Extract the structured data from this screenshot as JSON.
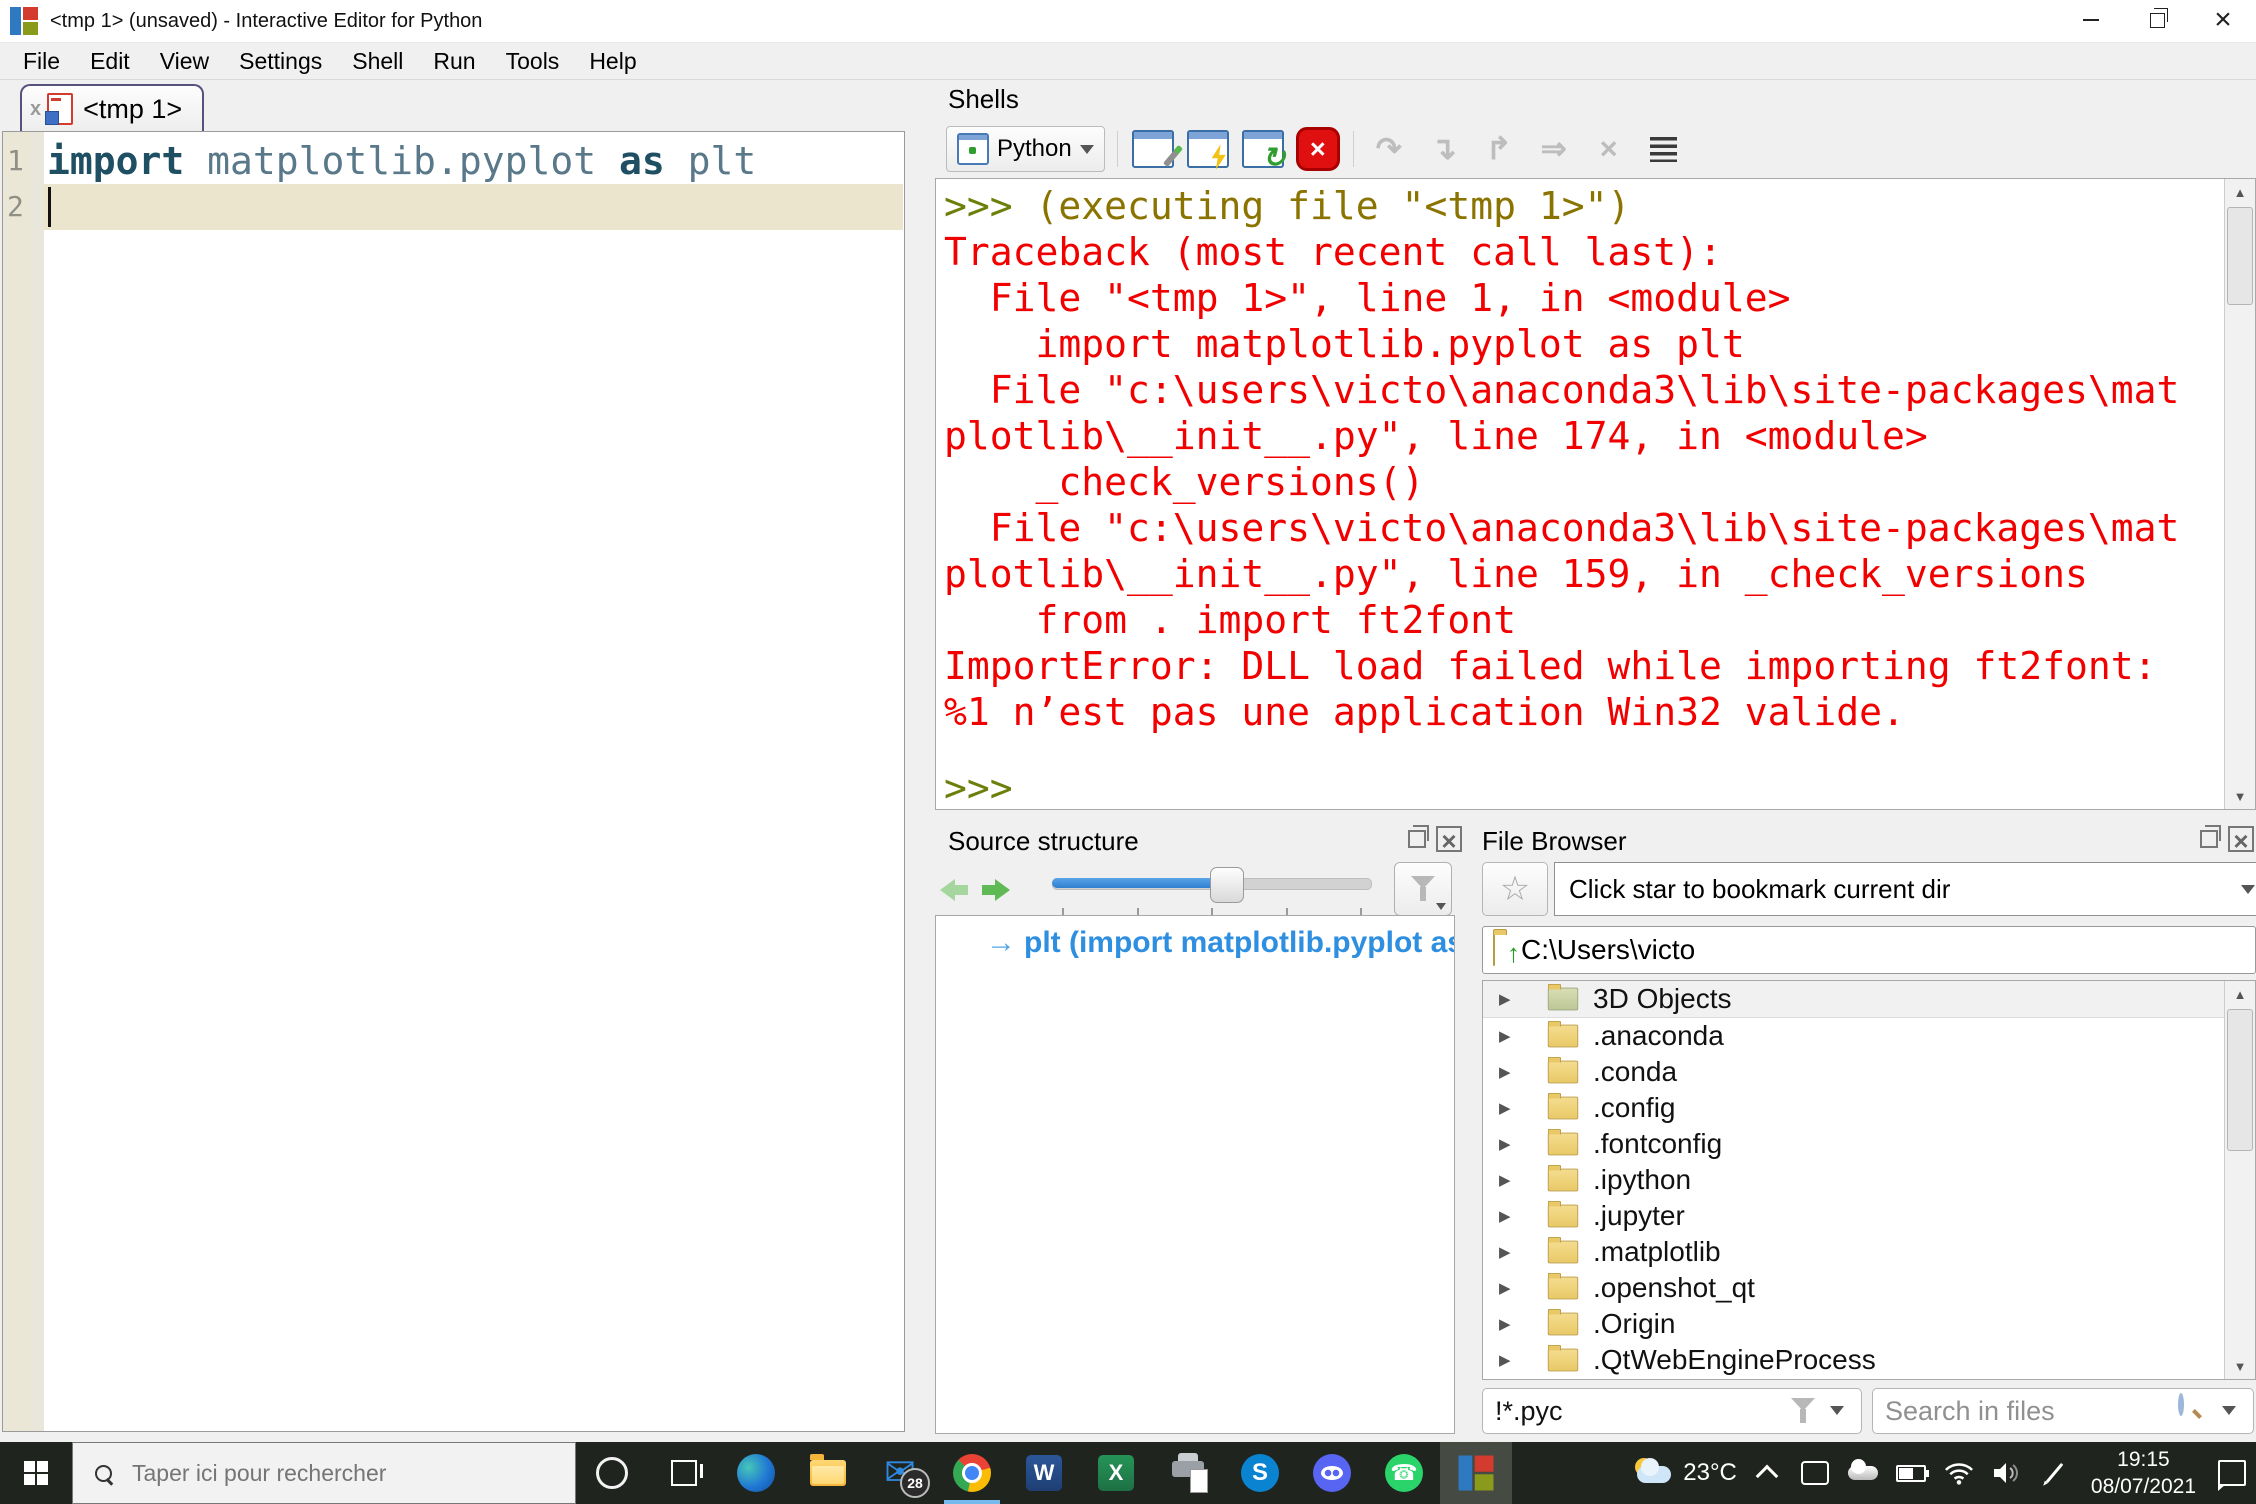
{
  "window": {
    "title": "<tmp 1> (unsaved) - Interactive Editor for Python"
  },
  "menu": {
    "items": [
      {
        "label": "File"
      },
      {
        "label": "Edit"
      },
      {
        "label": "View"
      },
      {
        "label": "Settings"
      },
      {
        "label": "Shell"
      },
      {
        "label": "Run"
      },
      {
        "label": "Tools"
      },
      {
        "label": "Help"
      }
    ]
  },
  "editor": {
    "tab_label": "<tmp 1>",
    "line_numbers": [
      {
        "n": "1"
      },
      {
        "n": "2"
      }
    ],
    "kw1": "import ",
    "module": "matplotlib.pyplot ",
    "kw2": "as ",
    "alias": "plt"
  },
  "shells": {
    "title": "Shells",
    "interpreter": "Python",
    "exec_prompt": ">>> ",
    "exec_text": "(executing file \"<tmp 1>\")",
    "traceback": [
      {
        "text": "Traceback (most recent call last):"
      },
      {
        "text": "  File \"<tmp 1>\", line 1, in <module>"
      },
      {
        "text": "    import matplotlib.pyplot as plt"
      },
      {
        "text": "  File \"c:\\users\\victo\\anaconda3\\lib\\site-packages\\mat"
      },
      {
        "text": "plotlib\\__init__.py\", line 174, in <module>"
      },
      {
        "text": "    _check_versions()"
      },
      {
        "text": "  File \"c:\\users\\victo\\anaconda3\\lib\\site-packages\\mat"
      },
      {
        "text": "plotlib\\__init__.py\", line 159, in _check_versions"
      },
      {
        "text": "    from . import ft2font"
      },
      {
        "text": "ImportError: DLL load failed while importing ft2font:"
      },
      {
        "text": "%1 n’est pas une application Win32 valide."
      }
    ],
    "end_prompt": ">>>"
  },
  "source_structure": {
    "title": "Source structure",
    "item_arrow": "→",
    "item_text": "plt (import matplotlib.pyplot as plt)"
  },
  "file_browser": {
    "title": "File Browser",
    "bookmark_text": "Click star to bookmark current dir",
    "path": "C:\\Users\\victo",
    "folders": [
      {
        "name": "3D Objects"
      },
      {
        "name": ".anaconda"
      },
      {
        "name": ".conda"
      },
      {
        "name": ".config"
      },
      {
        "name": ".fontconfig"
      },
      {
        "name": ".ipython"
      },
      {
        "name": ".jupyter"
      },
      {
        "name": ".matplotlib"
      },
      {
        "name": ".openshot_qt"
      },
      {
        "name": ".Origin"
      },
      {
        "name": ".QtWebEngineProcess"
      }
    ],
    "filter_value": "!*.pyc",
    "search_placeholder": "Search in files"
  },
  "taskbar": {
    "search_placeholder": "Taper ici pour rechercher",
    "mail_badge": "28",
    "temperature": "23°C",
    "time": "19:15",
    "date": "08/07/2021"
  }
}
